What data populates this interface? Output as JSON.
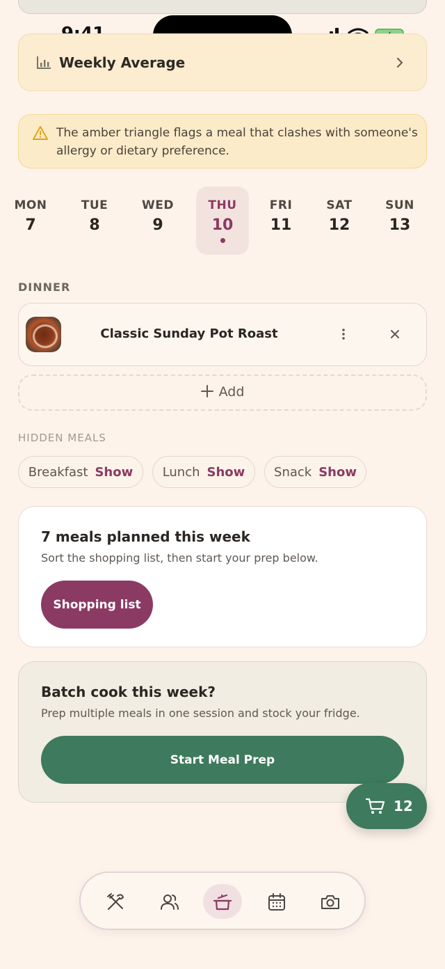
{
  "status": {
    "time": "9:41"
  },
  "weekly": {
    "title": "Weekly Average"
  },
  "warning": {
    "text": "The amber triangle flags a meal that clashes with someone's allergy or dietary preference."
  },
  "days": [
    {
      "name": "MON",
      "date": "7"
    },
    {
      "name": "TUE",
      "date": "8"
    },
    {
      "name": "WED",
      "date": "9"
    },
    {
      "name": "THU",
      "date": "10",
      "selected": true
    },
    {
      "name": "FRI",
      "date": "11"
    },
    {
      "name": "SAT",
      "date": "12"
    },
    {
      "name": "SUN",
      "date": "13"
    }
  ],
  "dinner": {
    "label": "DINNER",
    "meal_title": "Classic Sunday Pot Roast",
    "add_label": "Add"
  },
  "hidden_meals": {
    "label": "HIDDEN MEALS",
    "items": [
      {
        "name": "Breakfast",
        "action": "Show"
      },
      {
        "name": "Lunch",
        "action": "Show"
      },
      {
        "name": "Snack",
        "action": "Show"
      }
    ]
  },
  "plan": {
    "title": "7 meals planned this week",
    "subtitle": "Sort the shopping list, then start your prep below.",
    "button": "Shopping list"
  },
  "batch": {
    "title": "Batch cook this week?",
    "subtitle": "Prep multiple meals in one session and stock your fridge.",
    "button": "Start Meal Prep"
  },
  "cart": {
    "count": "12"
  },
  "nav": {
    "icons": [
      "utensils-icon",
      "people-icon",
      "pot-icon",
      "calendar-icon",
      "camera-icon"
    ],
    "active": "pot-icon"
  },
  "colors": {
    "accent": "#8b3a63",
    "green": "#3e7a5d",
    "background": "#fdf3ea",
    "warning": "#fcebc9"
  }
}
